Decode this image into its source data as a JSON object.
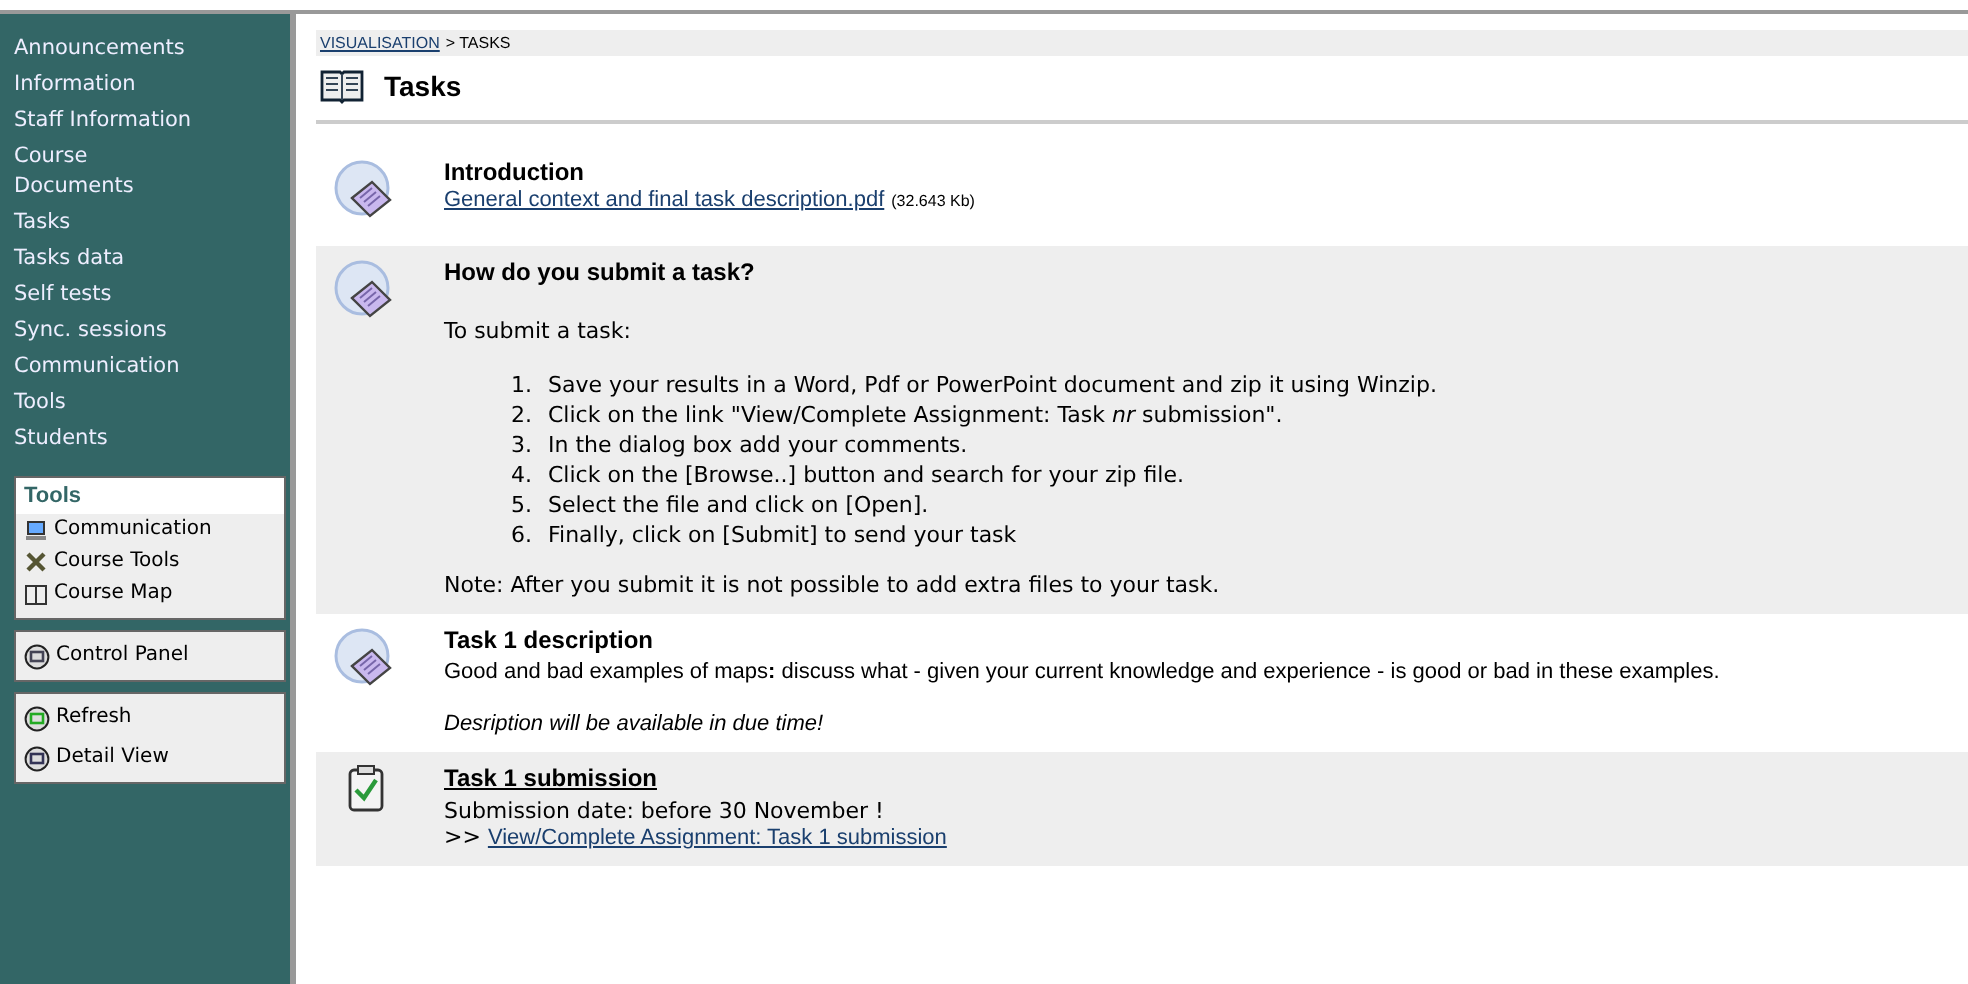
{
  "sidebar": {
    "nav": [
      "Announcements",
      "Information",
      "Staff Information",
      "Course\nDocuments",
      "Tasks",
      "Tasks data",
      "Self tests",
      "Sync. sessions",
      "Communication",
      "Tools",
      "Students"
    ],
    "panels": [
      {
        "title": "Tools",
        "items": [
          "Communication",
          "Course Tools",
          "Course Map"
        ]
      },
      {
        "items": [
          "Control Panel"
        ]
      },
      {
        "items": [
          "Refresh",
          "Detail View"
        ]
      }
    ]
  },
  "breadcrumb": {
    "link": "VISUALISATION",
    "rest": "> TASKS"
  },
  "title": "Tasks",
  "items": [
    {
      "kind": "document",
      "title": "Introduction",
      "link": "General context and final task description.pdf",
      "size": "(32.643 Kb)"
    },
    {
      "kind": "document",
      "title": "How do you submit a task?",
      "intro": "To submit a task:",
      "steps": [
        {
          "number": "1.",
          "text": "Save your results in a Word, Pdf or PowerPoint document and zip it using Winzip."
        },
        {
          "number": "2.",
          "text": "Click on the link \"View/Complete Assignment: Task *nr* submission\"."
        },
        {
          "number": "3.",
          "text": "In the dialog box add your comments."
        },
        {
          "number": "4.",
          "text": "Click on the [Browse..] button and search for your zip file."
        },
        {
          "number": "5.",
          "text": "Select the file and click on [Open]."
        },
        {
          "number": "6.",
          "text": "Finally, click on [Submit] to send your task"
        }
      ],
      "note": "Note: After you submit it is not possible to add extra files to your task."
    },
    {
      "kind": "document",
      "title": "Task 1 description",
      "body": "Good and bad examples of maps**:** discuss what - given your current knowledge and experience - is good or bad in these examples.",
      "remark": "Desription will be available in due time!"
    },
    {
      "kind": "assignment",
      "title": "Task 1 submission",
      "body": "Submission date: before 30 November !",
      "link_prefix": ">>",
      "link": "View/Complete Assignment: Task 1 submission"
    }
  ]
}
